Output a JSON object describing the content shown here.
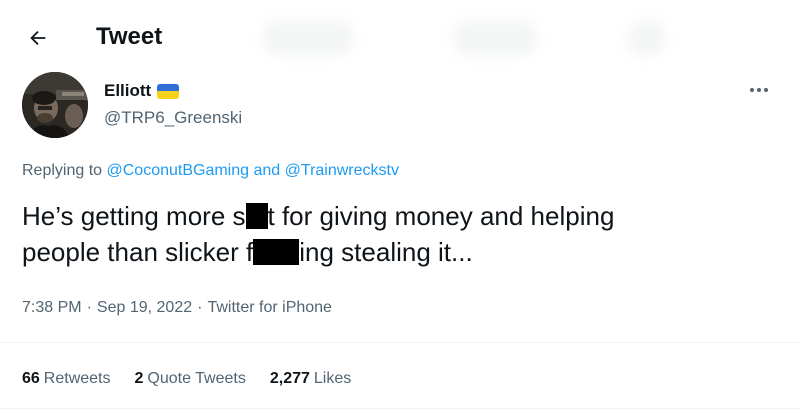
{
  "header": {
    "title": "Tweet"
  },
  "tweet": {
    "author": {
      "display_name": "Elliott",
      "handle": "@TRP6_Greenski"
    },
    "replying_prefix": "Replying to",
    "reply_to_1": "@CoconutBGaming",
    "reply_to_and": "and",
    "reply_to_2": "@Trainwreckstv",
    "text_line1_a": "He’s getting more s",
    "text_line1_b": "t for giving money and helping",
    "text_line2_a": "people than slicker f",
    "text_line2_b": "ing stealing it...",
    "time": "7:38 PM",
    "date": "Sep 19, 2022",
    "source": "Twitter for iPhone",
    "separator": "·"
  },
  "stats": {
    "retweets_count": "66",
    "retweets_label": "Retweets",
    "quotes_count": "2",
    "quotes_label": "Quote Tweets",
    "likes_count": "2,277",
    "likes_label": "Likes"
  },
  "colors": {
    "link": "#1d9bf0",
    "secondary_text": "#536471",
    "primary_text": "#0f1419",
    "flag_blue": "#2f6fd6",
    "flag_yellow": "#f7d21a"
  },
  "icons": {
    "back": "back-arrow-icon",
    "more": "more-options-icon",
    "flag": "ukraine-flag-icon"
  }
}
